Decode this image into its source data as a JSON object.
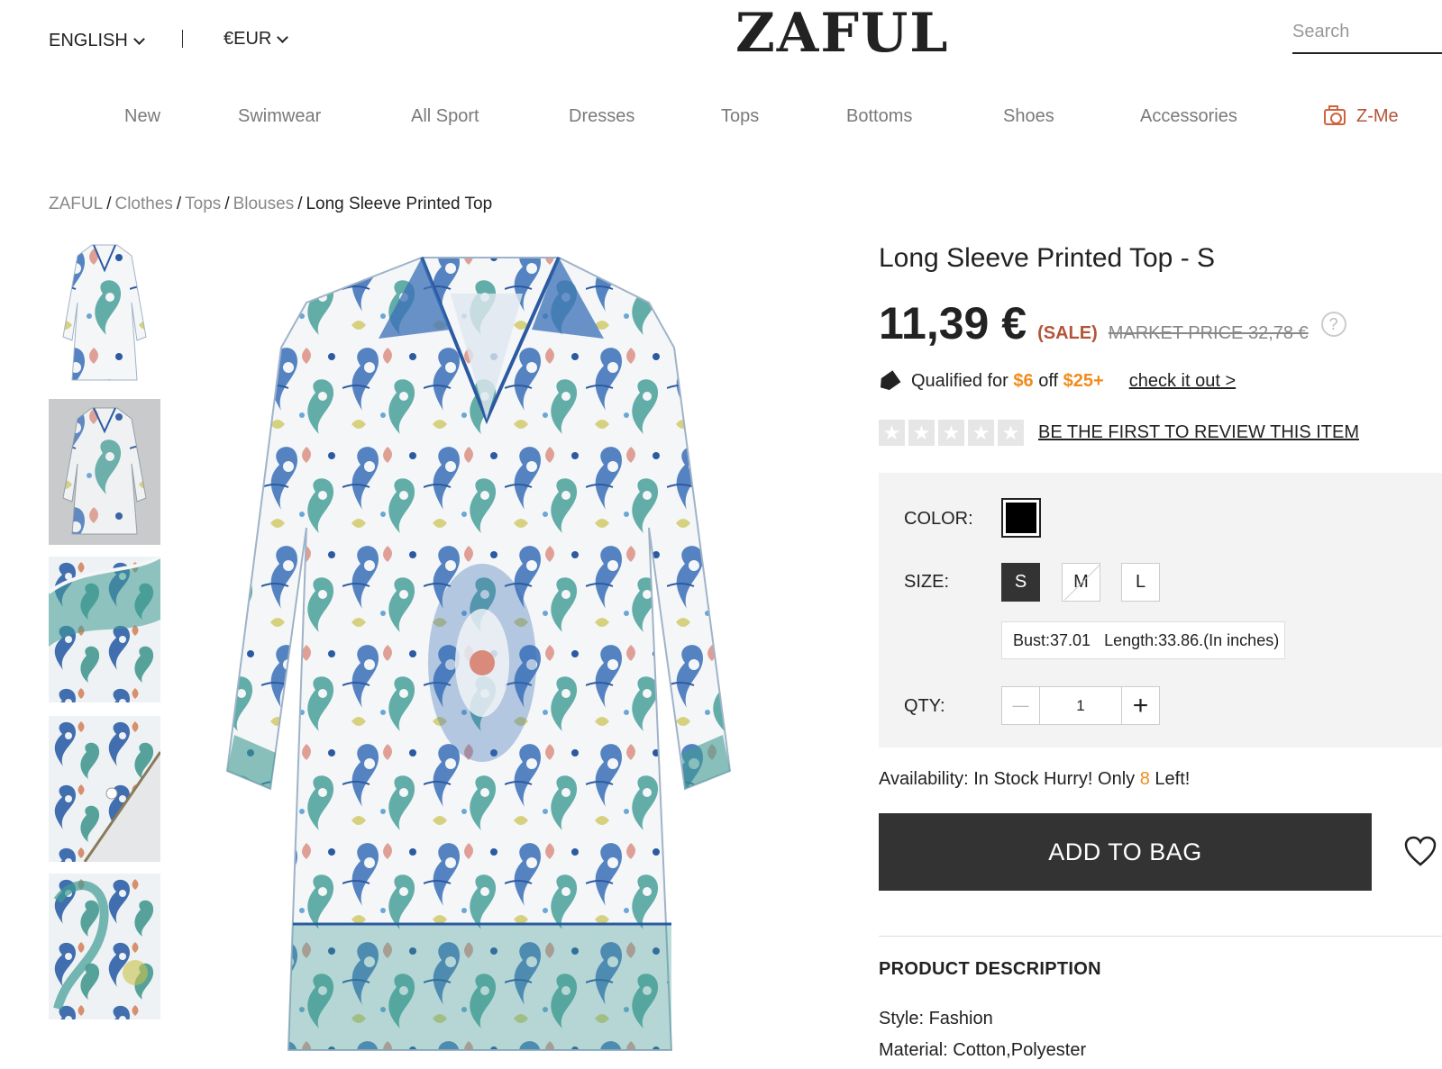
{
  "header": {
    "language": "ENGLISH",
    "currency": "€EUR",
    "logo": "ZAFUL",
    "search_placeholder": "Search"
  },
  "nav": {
    "items": [
      {
        "label": "New"
      },
      {
        "label": "Swimwear"
      },
      {
        "label": "All Sport"
      },
      {
        "label": "Dresses"
      },
      {
        "label": "Tops"
      },
      {
        "label": "Bottoms"
      },
      {
        "label": "Shoes"
      },
      {
        "label": "Accessories"
      },
      {
        "label": "Z-Me",
        "icon": "camera-icon"
      }
    ]
  },
  "breadcrumb": {
    "items": [
      "ZAFUL",
      "Clothes",
      "Tops",
      "Blouses"
    ],
    "current": "Long Sleeve Printed Top"
  },
  "product": {
    "title": "Long Sleeve Printed Top - S",
    "price": "11,39 €",
    "sale_label": "(SALE)",
    "market_price": "MARKET PRICE 32,78 €",
    "help_glyph": "?",
    "promo": {
      "prefix": "Qualified for",
      "discount": "$6",
      "middle": "off",
      "threshold": "$25+",
      "link": "check it out >"
    },
    "rating": {
      "stars": 5,
      "filled": 0,
      "review_link": "BE THE FIRST TO REVIEW THIS ITEM"
    },
    "options": {
      "color_label": "COLOR:",
      "selected_color": "#000000",
      "size_label": "SIZE:",
      "sizes": [
        {
          "label": "S",
          "state": "selected"
        },
        {
          "label": "M",
          "state": "disabled"
        },
        {
          "label": "L",
          "state": "available"
        }
      ],
      "measurements": "Bust:37.01   Length:33.86.(In inches)",
      "qty_label": "QTY:",
      "qty_value": "1",
      "minus_glyph": "—",
      "plus_glyph": "+"
    },
    "availability": {
      "prefix": "Availability: In Stock Hurry! Only",
      "count": "8",
      "suffix": "Left!"
    },
    "add_to_bag": "ADD TO BAG",
    "description": {
      "heading": "PRODUCT DESCRIPTION",
      "style": "Style: Fashion",
      "material": "Material: Cotton,Polyester"
    }
  },
  "colors": {
    "accent": "#b4543a",
    "orange": "#f08c1e",
    "dark_button": "#333333",
    "panel_bg": "#f3f3f3",
    "print_blue": "#3a6fb8",
    "print_teal": "#3f9b93"
  }
}
